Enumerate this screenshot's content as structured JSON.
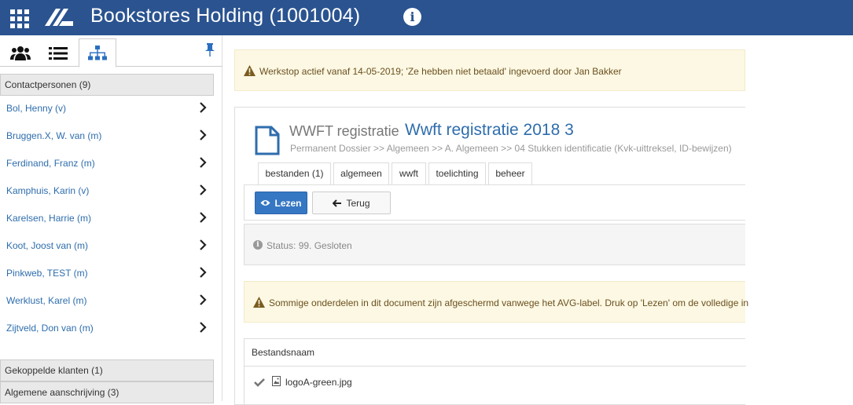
{
  "header": {
    "title": "Bookstores Holding (1001004)",
    "apps_icon": "grid-icon",
    "logo_icon": "brand-logo",
    "info_icon": "info-icon",
    "colors": {
      "bar": "#2a5390"
    }
  },
  "sidebar": {
    "tabs": [
      {
        "icon": "people-icon"
      },
      {
        "icon": "list-icon"
      },
      {
        "icon": "hierarchy-icon",
        "active": true
      }
    ],
    "pin_icon": "pin-icon",
    "contacts_header": "Contactpersonen (9)",
    "contacts": [
      {
        "name": "Bol, Henny (v)"
      },
      {
        "name": "Bruggen.X, W. van (m)"
      },
      {
        "name": "Ferdinand, Franz (m)"
      },
      {
        "name": "Kamphuis, Karin (v)"
      },
      {
        "name": "Karelsen, Harrie (m)"
      },
      {
        "name": "Koot, Joost van (m)"
      },
      {
        "name": "Pinkweb, TEST (m)"
      },
      {
        "name": "Werklust, Karel (m)"
      },
      {
        "name": "Zijtveld, Don van (m)"
      }
    ],
    "linked_clients": "Gekoppelde klanten (1)",
    "general_address": "Algemene aanschrijving (3)"
  },
  "main": {
    "work_stop_alert": "Werkstop actief vanaf 14-05-2019; 'Ze hebben niet betaald' ingevoerd door Jan Bakker",
    "doc_label": "WWFT registratie",
    "doc_title": "Wwft registratie 2018 3",
    "breadcrumb": "Permanent Dossier >> Algemeen >> A. Algemeen >> 04 Stukken identificatie (Kvk-uittreksel, ID-bewijzen)",
    "tabs": [
      {
        "label": "bestanden (1)",
        "active": true
      },
      {
        "label": "algemeen"
      },
      {
        "label": "wwft"
      },
      {
        "label": "toelichting"
      },
      {
        "label": "beheer"
      }
    ],
    "read_button": "Lezen",
    "back_button": "Terug",
    "status": "Status: 99. Gesloten",
    "avg_alert": "Sommige onderdelen in dit document zijn afgeschermd vanwege het AVG-label. Druk op 'Lezen' om de volledige in",
    "files_header": "Bestandsnaam",
    "files": [
      {
        "name": "logoA-green.jpg"
      }
    ]
  }
}
